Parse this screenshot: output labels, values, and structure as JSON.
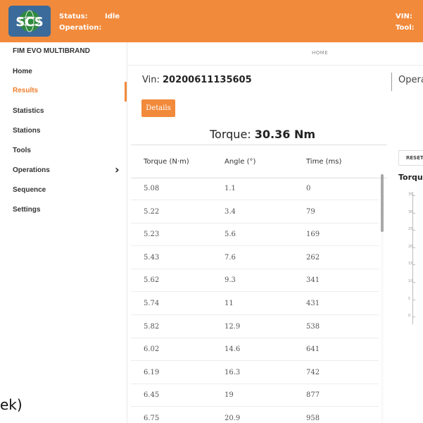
{
  "header": {
    "logo_text": "SCS",
    "status_label": "Status:",
    "status_value": "Idle",
    "operation_label": "Operation:",
    "vin_label": "VIN:",
    "tool_label": "Tool:",
    "background": "#f28a3b"
  },
  "sidebar": {
    "app_title": "FIM EVO MULTIBRAND",
    "items": [
      {
        "label": "Home"
      },
      {
        "label": "Results"
      },
      {
        "label": "Statistics"
      },
      {
        "label": "Stations"
      },
      {
        "label": "Tools"
      },
      {
        "label": "Operations"
      },
      {
        "label": "Sequence"
      },
      {
        "label": "Settings"
      }
    ],
    "active_color": "#f07d2b",
    "settings_chevron": "›"
  },
  "main": {
    "breadcrumb": "HOME",
    "vin_prefix": "Vin:",
    "vin_value": "20200611135605",
    "operation_label": "Opera",
    "details_button": "Details",
    "torque_prefix": "Torque:",
    "torque_value": "30.36 Nm",
    "table": {
      "headers": [
        "Torque (N·m)",
        "Angle (°)",
        "Time (ms)"
      ],
      "rows": [
        [
          "5.08",
          "1.1",
          "0"
        ],
        [
          "5.22",
          "3.4",
          "79"
        ],
        [
          "5.23",
          "5.6",
          "169"
        ],
        [
          "5.43",
          "7.6",
          "262"
        ],
        [
          "5.62",
          "9.3",
          "341"
        ],
        [
          "5.74",
          "11",
          "431"
        ],
        [
          "5.82",
          "12.9",
          "538"
        ],
        [
          "6.02",
          "14.6",
          "641"
        ],
        [
          "6.19",
          "16.3",
          "742"
        ],
        [
          "6.45",
          "19",
          "877"
        ],
        [
          "6.75",
          "20.9",
          "958"
        ]
      ]
    },
    "right_panel": {
      "reset_button": "RESET",
      "chart_title": "Torque",
      "y_ticks": [
        "35",
        "30",
        "25",
        "20",
        "15",
        "10",
        "5",
        "0"
      ]
    }
  },
  "footer_edge_text": "ek)"
}
